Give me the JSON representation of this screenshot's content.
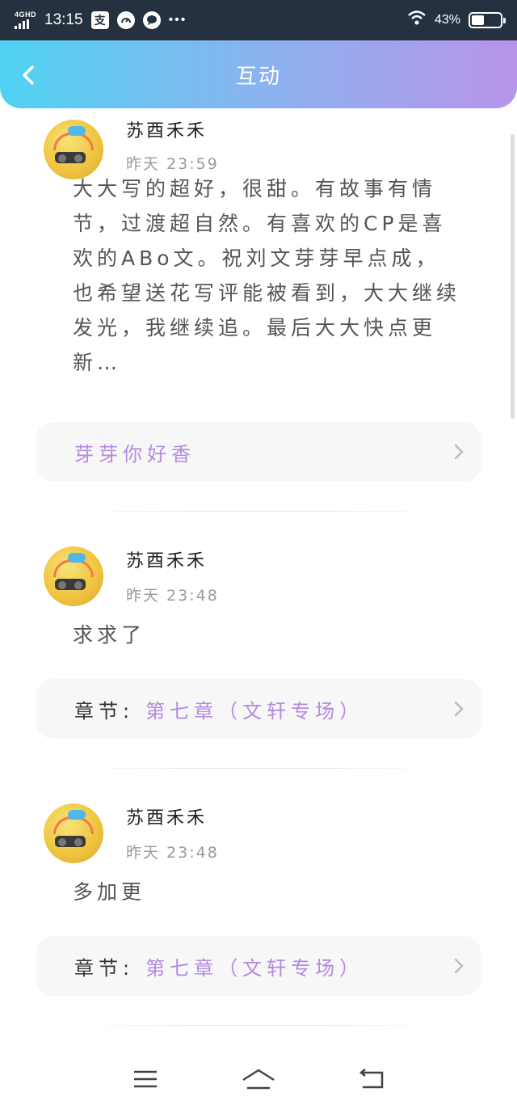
{
  "status_bar": {
    "network": "4GHD",
    "time": "13:15",
    "app_icon_label": "支",
    "battery": "43%",
    "battery_level": 0.43
  },
  "header": {
    "title": "互动"
  },
  "comments": [
    {
      "username": "苏酉禾禾",
      "time": "昨天 23:59",
      "text": "大大写的超好，很甜。有故事有情节，过渡超自然。有喜欢的CP是喜欢的ABo文。祝刘文芽芽早点成，也希望送花写评能被看到，大大继续发光，我继续追。最后大大快点更新…",
      "ref_prefix": "",
      "ref_title": "芽芽你好香"
    },
    {
      "username": "苏酉禾禾",
      "time": "昨天 23:48",
      "text": "求求了",
      "ref_prefix": "章节:",
      "ref_title": "第七章（文轩专场）"
    },
    {
      "username": "苏酉禾禾",
      "time": "昨天 23:48",
      "text": "多加更",
      "ref_prefix": "章节:",
      "ref_title": "第七章（文轩专场）"
    }
  ],
  "colors": {
    "header_gradient_start": "#4fd2f3",
    "header_gradient_end": "#b894ea",
    "ref_title": "#b48ae0",
    "status_bar": "#26313f"
  },
  "icons": [
    "back-arrow-icon",
    "chevron-right-icon",
    "menu-icon",
    "home-icon",
    "back-icon",
    "wifi-icon",
    "battery-icon"
  ]
}
